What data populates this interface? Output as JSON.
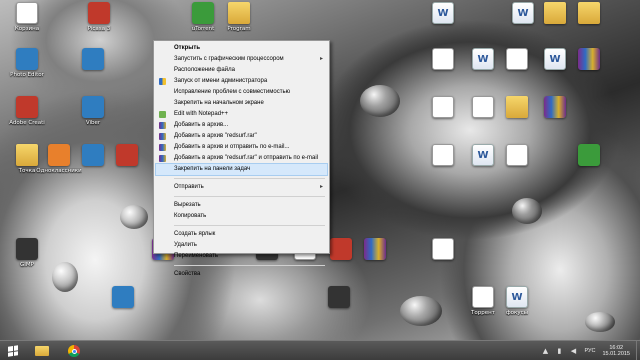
{
  "desktop_icons": [
    {
      "id": "i1",
      "label": "Корзина",
      "kind": "doc"
    },
    {
      "id": "i2",
      "label": "Picasa 3",
      "kind": "red"
    },
    {
      "id": "i3",
      "label": "uTorrent",
      "kind": "green"
    },
    {
      "id": "i4",
      "label": "Program",
      "kind": "folder"
    },
    {
      "id": "i5",
      "label": "",
      "kind": "word"
    },
    {
      "id": "i6",
      "label": "",
      "kind": "word"
    },
    {
      "id": "i7",
      "label": "",
      "kind": "folder"
    },
    {
      "id": "i8",
      "label": "",
      "kind": "folder"
    },
    {
      "id": "i9",
      "label": "Photo Editor",
      "kind": "app"
    },
    {
      "id": "i10",
      "label": "",
      "kind": "app"
    },
    {
      "id": "i11",
      "label": "Adobe Creati",
      "kind": "red"
    },
    {
      "id": "i12",
      "label": "Viber",
      "kind": "app"
    },
    {
      "id": "i13",
      "label": "Точка",
      "kind": "folder"
    },
    {
      "id": "i14",
      "label": "Одноклассники",
      "kind": "orange"
    },
    {
      "id": "i15",
      "label": "",
      "kind": "app"
    },
    {
      "id": "i16",
      "label": "",
      "kind": "red"
    },
    {
      "id": "i17",
      "label": "GIMP",
      "kind": "dark"
    },
    {
      "id": "i18",
      "label": "",
      "kind": "rar"
    },
    {
      "id": "i19",
      "label": "",
      "kind": "dark"
    },
    {
      "id": "i20",
      "label": "",
      "kind": "doc"
    },
    {
      "id": "i21",
      "label": "",
      "kind": "red"
    },
    {
      "id": "i22",
      "label": "",
      "kind": "rar"
    },
    {
      "id": "i23",
      "label": "",
      "kind": "dark"
    },
    {
      "id": "i24",
      "label": "",
      "kind": "app"
    },
    {
      "id": "i25",
      "label": "",
      "kind": "doc"
    },
    {
      "id": "i26",
      "label": "",
      "kind": "word"
    },
    {
      "id": "i27",
      "label": "",
      "kind": "doc"
    },
    {
      "id": "i28",
      "label": "",
      "kind": "word"
    },
    {
      "id": "i29",
      "label": "",
      "kind": "rar"
    },
    {
      "id": "i30",
      "label": "",
      "kind": "doc"
    },
    {
      "id": "i31",
      "label": "",
      "kind": "doc"
    },
    {
      "id": "i32",
      "label": "",
      "kind": "folder"
    },
    {
      "id": "i33",
      "label": "",
      "kind": "rar"
    },
    {
      "id": "i34",
      "label": "",
      "kind": "doc"
    },
    {
      "id": "i35",
      "label": "",
      "kind": "word"
    },
    {
      "id": "i36",
      "label": "",
      "kind": "doc"
    },
    {
      "id": "i37",
      "label": "",
      "kind": "doc"
    },
    {
      "id": "i38",
      "label": "Торрент",
      "kind": "doc"
    },
    {
      "id": "i39",
      "label": "фокусы",
      "kind": "word"
    },
    {
      "id": "i40",
      "label": "",
      "kind": "green"
    }
  ],
  "context_menu": {
    "items": [
      {
        "label": "Открыть",
        "bold": true
      },
      {
        "label": "Запустить с графическим процессором",
        "arrow": true
      },
      {
        "label": "Расположение файла"
      },
      {
        "label": "Запуск от имени администратора",
        "icon": "shield"
      },
      {
        "label": "Исправление проблем с совместимостью"
      },
      {
        "label": "Закрепить на начальном экране"
      },
      {
        "label": "Edit with Notepad++",
        "icon": "np"
      },
      {
        "label": "Добавить в архив...",
        "icon": "rar"
      },
      {
        "label": "Добавить в архив \"redsurf.rar\"",
        "icon": "rar"
      },
      {
        "label": "Добавить в архив и отправить по e-mail...",
        "icon": "rar"
      },
      {
        "label": "Добавить в архив \"redsurf.rar\" и отправить по e-mail",
        "icon": "rar"
      },
      {
        "label": "Закрепить на панели задач",
        "highlighted": true
      },
      {
        "sep": true
      },
      {
        "label": "Отправить",
        "arrow": true
      },
      {
        "sep": true
      },
      {
        "label": "Вырезать"
      },
      {
        "label": "Копировать"
      },
      {
        "sep": true
      },
      {
        "label": "Создать ярлык"
      },
      {
        "label": "Удалить"
      },
      {
        "label": "Переименовать"
      },
      {
        "sep": true
      },
      {
        "label": "Свойства"
      }
    ]
  },
  "taskbar": {
    "language": "РУС",
    "time": "16:02",
    "date": "15.01.2015"
  },
  "colors": {
    "menu_highlight": "#d5e8fb",
    "taskbar": "#3c3c3c"
  }
}
